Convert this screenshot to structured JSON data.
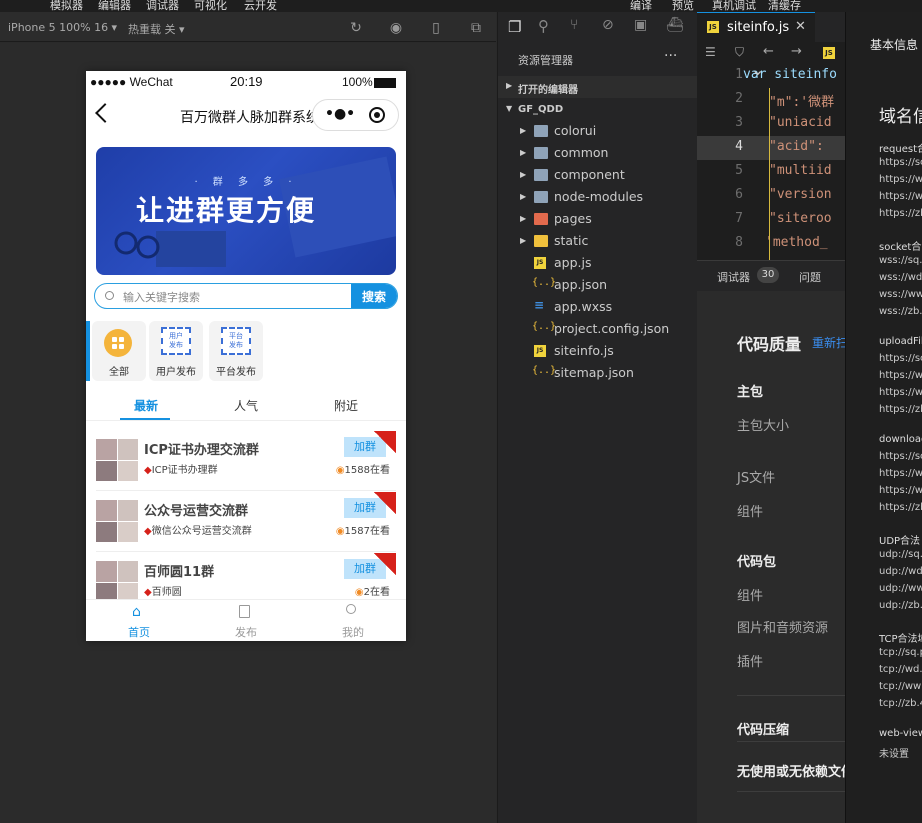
{
  "topbar": {
    "items": [
      "模拟器",
      "编辑器",
      "调试器",
      "可视化",
      "云开发",
      "编译",
      "预览",
      "真机调试",
      "清缓存"
    ]
  },
  "simulator": {
    "device": "iPhone 5 100% 16 ▾",
    "hot_reload": "热重载 关 ▾"
  },
  "phone": {
    "status": {
      "carrier": "●●●●● WeChat",
      "time": "20:19",
      "battery": "100%"
    },
    "nav_title": "百万微群人脉加群系统",
    "capsule_more": "•●•",
    "banner": {
      "sub": "· 群 多 多 ·",
      "title": "让进群更方便"
    },
    "search": {
      "placeholder": "输入关键字搜索",
      "button": "搜索"
    },
    "categories": [
      {
        "label": "全部",
        "tag": ""
      },
      {
        "label": "用户发布",
        "tag": "用户\n发布"
      },
      {
        "label": "平台发布",
        "tag": "平台\n发布"
      }
    ],
    "tabs": [
      "最新",
      "人气",
      "附近"
    ],
    "items": [
      {
        "title": "ICP证书办理交流群",
        "sub": "ICP证书办理群",
        "viewers": "1588在看",
        "join": "加群",
        "ribbon": "推荐"
      },
      {
        "title": "公众号运营交流群",
        "sub": "微信公众号运营交流群",
        "viewers": "1587在看",
        "join": "加群",
        "ribbon": "推荐"
      },
      {
        "title": "百师圆11群",
        "sub": "百师圆",
        "viewers": "2在看",
        "join": "加群",
        "ribbon": "推荐"
      }
    ],
    "tabbar": [
      {
        "label": "首页"
      },
      {
        "label": "发布"
      },
      {
        "label": "我的"
      }
    ]
  },
  "explorer": {
    "title": "资源管理器",
    "more": "···",
    "open_editors": "打开的编辑器",
    "project": "GF_QDD",
    "files": [
      {
        "name": "colorui",
        "type": "folder"
      },
      {
        "name": "common",
        "type": "folder"
      },
      {
        "name": "component",
        "type": "folder"
      },
      {
        "name": "node-modules",
        "type": "folder"
      },
      {
        "name": "pages",
        "type": "folder-pages"
      },
      {
        "name": "static",
        "type": "folder-static"
      },
      {
        "name": "app.js",
        "type": "js"
      },
      {
        "name": "app.json",
        "type": "json"
      },
      {
        "name": "app.wxss",
        "type": "css"
      },
      {
        "name": "project.config.json",
        "type": "json"
      },
      {
        "name": "siteinfo.js",
        "type": "js"
      },
      {
        "name": "sitemap.json",
        "type": "json"
      }
    ]
  },
  "editor": {
    "tab": "siteinfo.js",
    "lines": [
      {
        "n": "1",
        "code": "var siteinfo",
        "kw": "var"
      },
      {
        "n": "2",
        "code": "\"m\":'微群"
      },
      {
        "n": "3",
        "code": "\"uniacid"
      },
      {
        "n": "4",
        "code": "\"acid\": "
      },
      {
        "n": "5",
        "code": "\"multiid"
      },
      {
        "n": "6",
        "code": "\"version"
      },
      {
        "n": "7",
        "code": "\"siteroo"
      },
      {
        "n": "8",
        "code": "'method_"
      }
    ]
  },
  "panel": {
    "tabs": [
      "调试器",
      "问题"
    ],
    "badge": "30",
    "heading": "代码质量",
    "refresh": "重新扫",
    "rows": [
      {
        "text": "主包",
        "kind": "section"
      },
      {
        "text": "主包大小",
        "kind": "muted"
      },
      {
        "text": "JS文件",
        "kind": "muted"
      },
      {
        "text": "组件",
        "kind": "muted"
      },
      {
        "text": "代码包",
        "kind": "section"
      },
      {
        "text": "组件",
        "kind": "muted"
      },
      {
        "text": "图片和音频资源",
        "kind": "muted"
      },
      {
        "text": "插件",
        "kind": "muted"
      },
      {
        "text": "代码压缩",
        "kind": "section"
      },
      {
        "text": "无使用或无依赖文件",
        "kind": "section"
      }
    ]
  },
  "right": {
    "basic": "基本信息",
    "domain": "域名信",
    "blocks": [
      {
        "head": "request合",
        "lines": [
          "https://sc",
          "https://w",
          "https://w",
          "https://zb"
        ]
      },
      {
        "head": "socket合法",
        "lines": [
          "wss://sq.",
          "wss://wd.",
          "wss://ww",
          "wss://zb."
        ]
      },
      {
        "head": "uploadFil",
        "lines": [
          "https://sc",
          "https://w",
          "https://w",
          "https://zb"
        ]
      },
      {
        "head": "download",
        "lines": [
          "https://sc",
          "https://w",
          "https://w",
          "https://zb"
        ]
      },
      {
        "head": "UDP合法",
        "lines": [
          "udp://sq.",
          "udp://wd",
          "udp://ww",
          "udp://zb."
        ]
      },
      {
        "head": "TCP合法域",
        "lines": [
          "tcp://sq.p",
          "tcp://wd.",
          "tcp://ww",
          "tcp://zb.4"
        ]
      },
      {
        "head": "web-view",
        "lines": [
          "未设置"
        ]
      }
    ]
  }
}
